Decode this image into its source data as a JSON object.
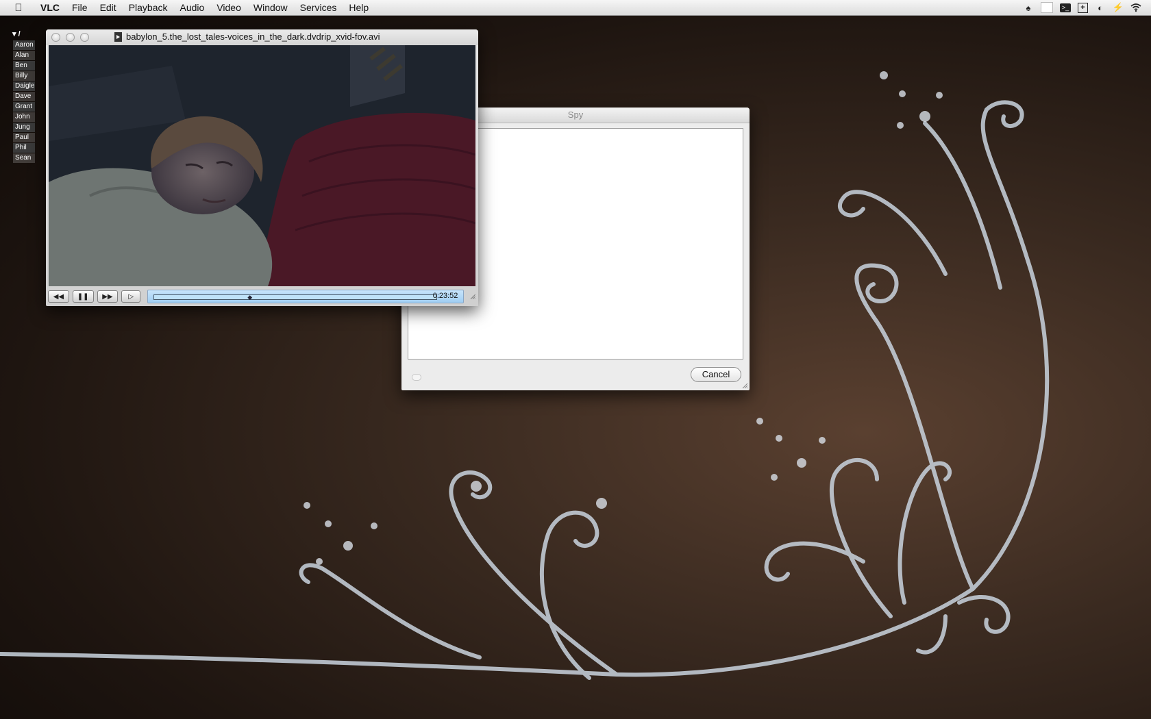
{
  "menubar": {
    "app": "VLC",
    "items": [
      "File",
      "Edit",
      "Playback",
      "Audio",
      "Video",
      "Window",
      "Services",
      "Help"
    ],
    "status_icons": [
      "growl-icon",
      "blank-icon",
      "terminal-icon",
      "add-icon",
      "palette-icon",
      "bolt-icon",
      "wifi-icon"
    ]
  },
  "sidebar": {
    "root": "/",
    "users": [
      "Aaron",
      "Alan",
      "Ben",
      "Billy",
      "Daigle",
      "Dave",
      "Grant",
      "John",
      "Jung",
      "Paul",
      "Phil",
      "Sean"
    ]
  },
  "spy_window": {
    "title": "Spy",
    "textarea_value": "",
    "cancel_label": "Cancel"
  },
  "vlc_window": {
    "title": "babylon_5.the_lost_tales-voices_in_the_dark.dvdrip_xvid-fov.avi",
    "time": "0:23:52",
    "progress": 0.34,
    "controls": [
      "rewind",
      "pause",
      "fast-forward",
      "fullscreen"
    ]
  },
  "colors": {
    "timeline": "#a9d6f5",
    "wallpaper_dark": "#1e1510",
    "ornament": "#c9d2dc"
  }
}
